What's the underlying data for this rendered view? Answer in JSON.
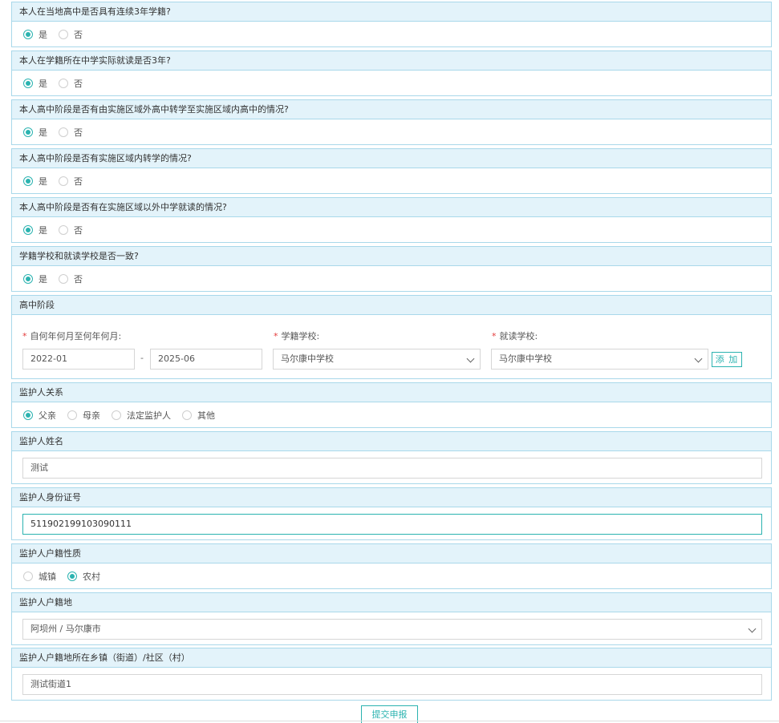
{
  "yes_no_questions": [
    {
      "title": "本人在当地高中是否具有连续3年学籍?",
      "yes": "是",
      "no": "否",
      "selected": "yes"
    },
    {
      "title": "本人在学籍所在中学实际就读是否3年?",
      "yes": "是",
      "no": "否",
      "selected": "yes"
    },
    {
      "title": "本人高中阶段是否有由实施区域外高中转学至实施区域内高中的情况?",
      "yes": "是",
      "no": "否",
      "selected": "yes"
    },
    {
      "title": "本人高中阶段是否有实施区域内转学的情况?",
      "yes": "是",
      "no": "否",
      "selected": "yes"
    },
    {
      "title": "本人高中阶段是否有在实施区域以外中学就读的情况?",
      "yes": "是",
      "no": "否",
      "selected": "yes"
    },
    {
      "title": "学籍学校和就读学校是否一致?",
      "yes": "是",
      "no": "否",
      "selected": "yes"
    }
  ],
  "high_school": {
    "title": "高中阶段",
    "required_mark": "*",
    "period_label": "自何年何月至何年何月:",
    "start": "2022-01",
    "separator": "-",
    "end": "2025-06",
    "registered_school_label": "学籍学校:",
    "registered_school": "马尔康中学校",
    "attended_school_label": "就读学校:",
    "attended_school": "马尔康中学校",
    "add_button": "添 加"
  },
  "guardian_relation": {
    "title": "监护人关系",
    "options": [
      "父亲",
      "母亲",
      "法定监护人",
      "其他"
    ],
    "selected_index": 0
  },
  "guardian_name": {
    "title": "监护人姓名",
    "value": "测试"
  },
  "guardian_id": {
    "title": "监护人身份证号",
    "value": "511902199103090111"
  },
  "guardian_hukou_type": {
    "title": "监护人户籍性质",
    "options": [
      "城镇",
      "农村"
    ],
    "selected_index": 1
  },
  "guardian_hukou_place": {
    "title": "监护人户籍地",
    "value": "阿坝州 / 马尔康市"
  },
  "guardian_street": {
    "title": "监护人户籍地所在乡镇（街道）/社区（村）",
    "value": "测试街道1"
  },
  "submit_button": "提交申报",
  "colors": {
    "accent": "#2bb3b0",
    "header_bg": "#e3f3fa",
    "border": "#a9d8ea",
    "required": "#e43b3b"
  }
}
